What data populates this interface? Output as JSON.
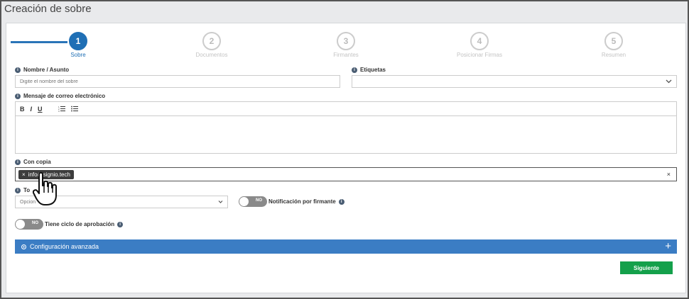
{
  "page": {
    "title": "Creación de sobre"
  },
  "stepper": {
    "steps": [
      {
        "num": "1",
        "label": "Sobre"
      },
      {
        "num": "2",
        "label": "Documentos"
      },
      {
        "num": "3",
        "label": "Firmantes"
      },
      {
        "num": "4",
        "label": "Posicionar Firmas"
      },
      {
        "num": "5",
        "label": "Resumen"
      }
    ]
  },
  "form": {
    "name": {
      "label": "Nombre / Asunto",
      "placeholder": "Digite el nombre del sobre"
    },
    "tags": {
      "label": "Etiquetas"
    },
    "email_message": {
      "label": "Mensaje de correo electrónico",
      "toolbar": [
        "B",
        "I",
        "U",
        "ordered-list-icon",
        "unordered-list-icon"
      ]
    },
    "cc": {
      "label": "Con copia",
      "chip": "info@signio.tech",
      "chip_remove": "×",
      "clear": "×"
    },
    "type": {
      "label": "To",
      "value": "Opcion"
    },
    "notify": {
      "toggle": "NO",
      "label": "Notificación por firmante"
    },
    "approval": {
      "toggle": "NO",
      "label": "Tiene ciclo de aprobación"
    },
    "advanced": {
      "label": "Configuración avanzada",
      "plus": "+"
    },
    "next": {
      "label": "Siguiente"
    }
  },
  "colors": {
    "primary": "#1f6fb5",
    "bar": "#3b7dc4",
    "success": "#14a04b"
  }
}
